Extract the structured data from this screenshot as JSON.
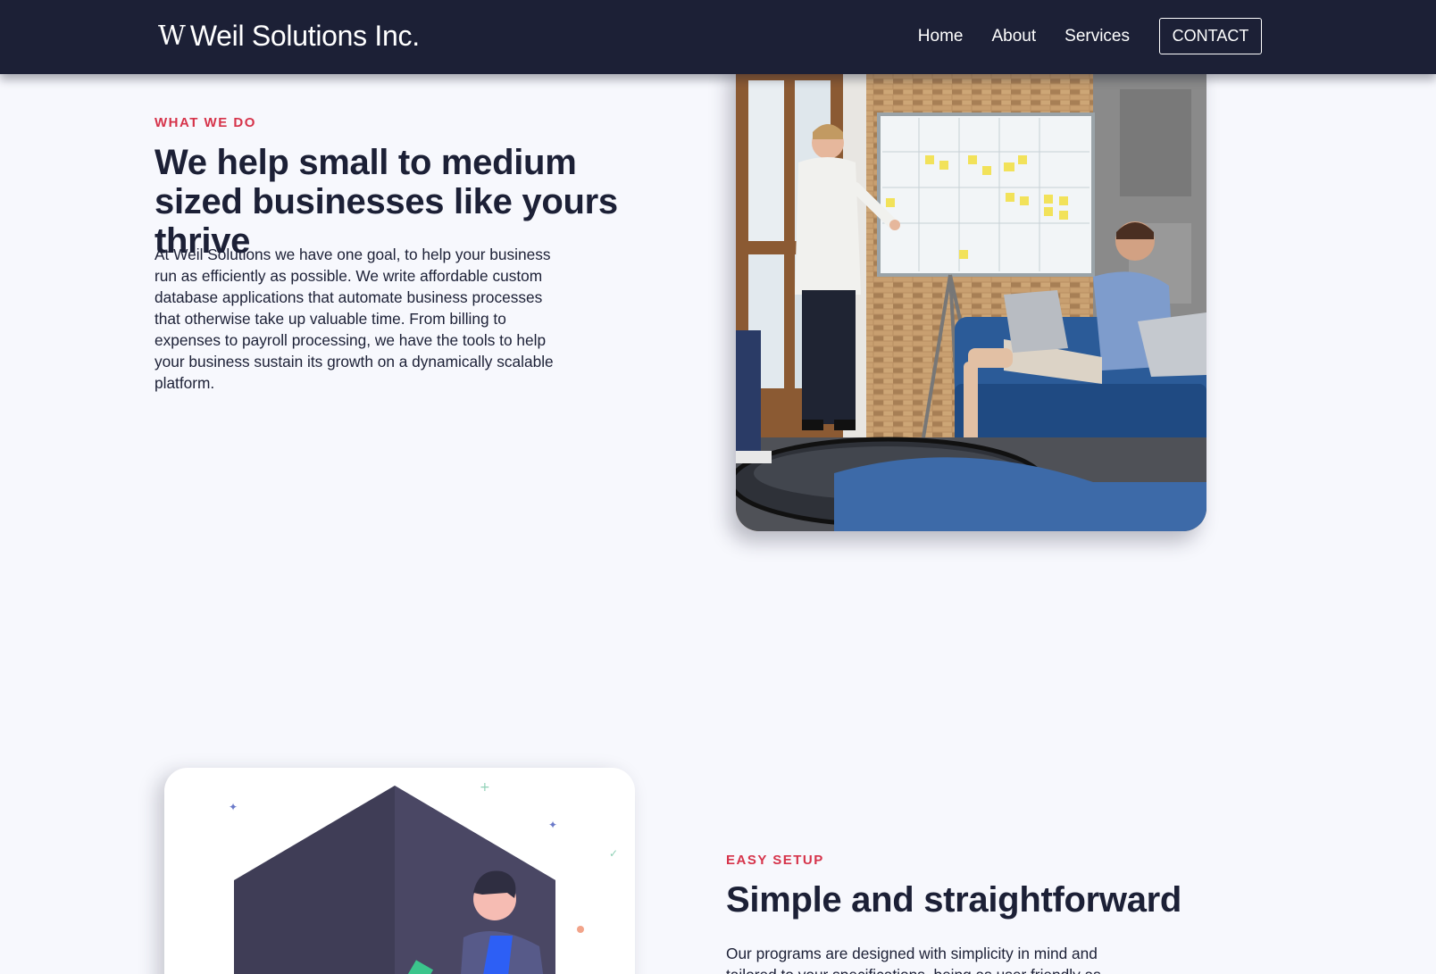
{
  "header": {
    "logo_mark": "W",
    "brand_name": "Weil Solutions Inc.",
    "nav": [
      "Home",
      "About",
      "Services"
    ],
    "contact_label": "CONTACT"
  },
  "section_what_we_do": {
    "eyebrow": "WHAT WE DO",
    "heading": "We help small to medium sized businesses like yours thrive",
    "body": "At Weil Solutions we have one goal, to help your business run as efficiently as possible. We write affordable custom database applications that automate business processes that otherwise take up valuable time. From billing to expenses to payroll processing, we have the tools to help your business sustain its growth on a dynamically scalable platform."
  },
  "section_easy_setup": {
    "eyebrow": "EASY SETUP",
    "heading": "Simple and straightforward",
    "body": "Our programs are designed with simplicity in mind and tailored to your specifications, being as user friendly as"
  },
  "colors": {
    "header_bg": "#1c2036",
    "accent": "#d6334a",
    "page_bg": "#f7f8fd",
    "text": "#1c2036"
  }
}
